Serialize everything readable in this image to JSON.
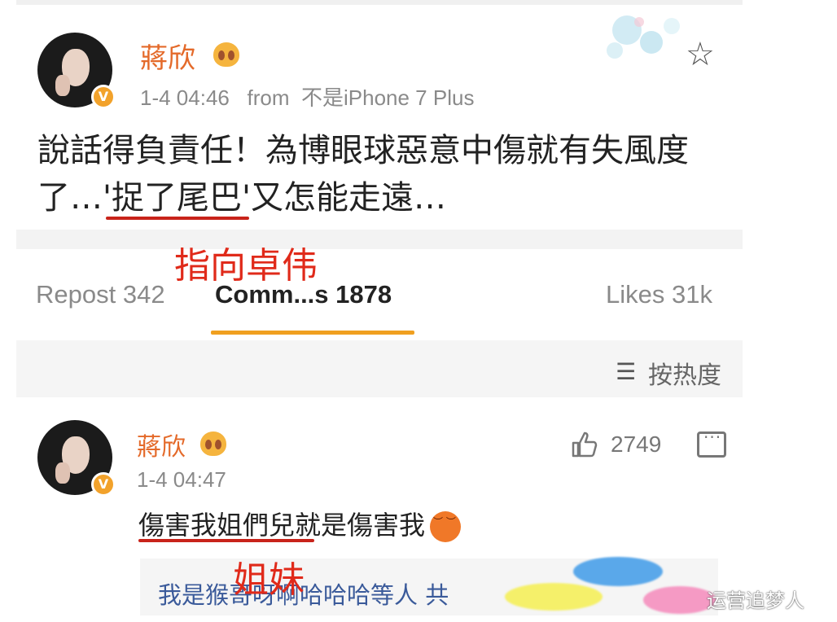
{
  "post": {
    "username": "蔣欣",
    "timestamp": "1-4 04:46",
    "from_label": "from",
    "device": "不是iPhone 7 Plus",
    "text_line1": "說話得負責任！為博眼球惡意中傷就有失風度",
    "text_line2_prefix": "了…'",
    "text_line2_highlight": "捉了尾巴",
    "text_line2_suffix": "'又怎能走遠…"
  },
  "annotations": {
    "pointer": "指向卓伟",
    "sisters": "姐妹"
  },
  "stats": {
    "repost": "Repost 342",
    "comments": "Comm...s 1878",
    "likes": "Likes 31k"
  },
  "sort": {
    "label": "按热度"
  },
  "comment": {
    "username": "蔣欣",
    "timestamp": "1-4 04:47",
    "like_count": "2749",
    "text_underlined": "傷害我姐們兒",
    "text_rest": "就是傷害我",
    "reply_preview": "我是猴哥呀啊哈哈哈等人 共"
  },
  "watermark": "运营追梦人",
  "colors": {
    "username": "#e46a2a",
    "accent_underline": "#f0a020",
    "annotation_red": "#e02a1a",
    "reply_link": "#3a5a9a"
  },
  "icons": {
    "favorite": "star-icon",
    "sort": "sort-icon",
    "like": "thumbs-up-icon",
    "reply": "comment-icon",
    "verified": "verified-badge-icon"
  }
}
